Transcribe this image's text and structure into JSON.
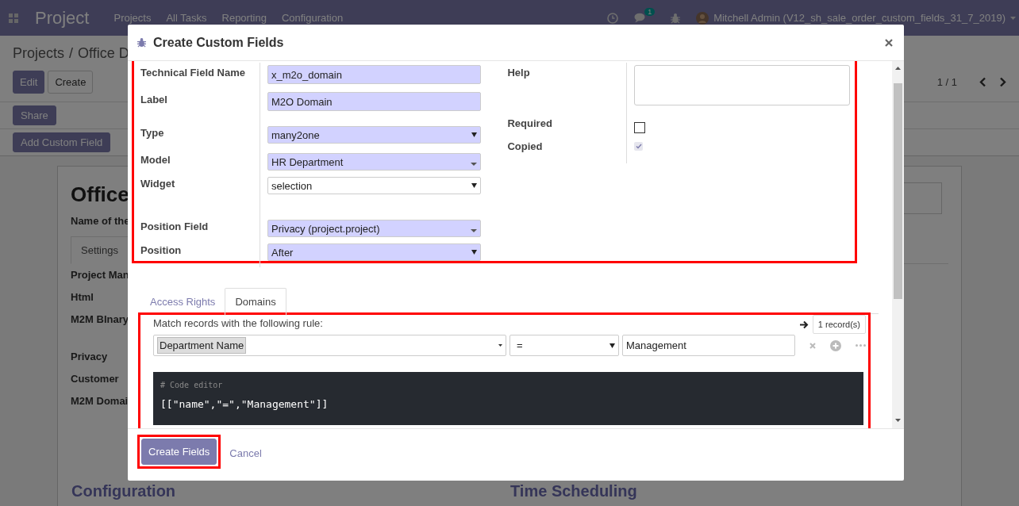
{
  "navbar": {
    "app_name": "Project",
    "menu": [
      "Projects",
      "All Tasks",
      "Reporting",
      "Configuration"
    ],
    "message_count": "1",
    "user": "Mitchell Admin (V12_sh_sale_order_custom_fields_31_7_2019)"
  },
  "breadcrumb": [
    "Projects",
    "/",
    "Office D"
  ],
  "buttons": [
    "Edit",
    "Create"
  ],
  "pager": "1 / 1",
  "actions": [
    "Share",
    "Add Custom Field"
  ],
  "record": {
    "title": "Office",
    "subtitle": "Name of the",
    "tabs": [
      {
        "label": "Settings",
        "selected": true
      }
    ],
    "fields": [
      "Project Man",
      "Html",
      "M2M BInary",
      "Privacy",
      "Customer",
      "M2M Domai"
    ],
    "sections": [
      "Configuration",
      "Time Scheduling"
    ]
  },
  "dialog": {
    "title": "Create Custom Fields",
    "form": {
      "highlighted": true,
      "left_fields": [
        {
          "label": "Technical Field Name",
          "kind": "input",
          "value": "x_m2o_domain",
          "required": true
        },
        {
          "label": "Label",
          "kind": "input",
          "value": "M2O Domain",
          "required": true
        },
        {
          "label": "Type",
          "kind": "select",
          "value": "many2one",
          "required": true
        },
        {
          "label": "Model",
          "kind": "many2one",
          "value": "HR Department",
          "required": true
        },
        {
          "label": "Widget",
          "kind": "select",
          "value": "selection",
          "required": false
        },
        {
          "label": "Position Field",
          "kind": "many2one",
          "value": "Privacy (project.project)",
          "required": true
        },
        {
          "label": "Position",
          "kind": "select",
          "value": "After",
          "required": true
        }
      ],
      "right_fields": [
        {
          "label": "Help",
          "kind": "textarea"
        },
        {
          "label": "Required",
          "kind": "checkbox",
          "checked": false,
          "disabled": false
        },
        {
          "label": "Copied",
          "kind": "checkbox",
          "checked": true,
          "disabled": true
        }
      ]
    },
    "tabs": [
      {
        "label": "Access Rights",
        "selected": false
      },
      {
        "label": "Domains",
        "selected": true
      }
    ],
    "domain": {
      "highlighted": true,
      "rule_text": "Match records with the following rule:",
      "record_count": "1 record(s)",
      "condition": {
        "field": "Department Name",
        "operator": "=",
        "value": "Management"
      },
      "code_comment": "# Code editor",
      "code": "[[\"name\",\"=\",\"Management\"]]"
    },
    "footer": {
      "primary": {
        "label": "Create Fields",
        "highlighted": true
      },
      "cancel": "Cancel"
    }
  }
}
